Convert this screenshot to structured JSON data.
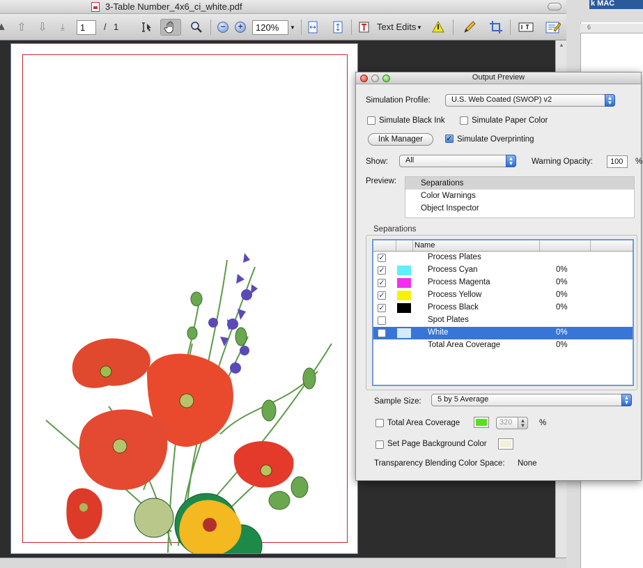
{
  "window": {
    "title": "3-Table Number_4x6_ci_white.pdf",
    "right_app_label": "k MAC"
  },
  "toolbar": {
    "page_current": "1",
    "page_sep": "/",
    "page_total": "1",
    "zoom": "120%",
    "text_edits": "Text Edits"
  },
  "ruler": {
    "mark": "6"
  },
  "panel": {
    "title": "Output Preview",
    "simulation_profile_label": "Simulation Profile:",
    "simulation_profile": "U.S. Web Coated (SWOP) v2",
    "simulate_black_ink": "Simulate Black Ink",
    "simulate_paper_color": "Simulate Paper Color",
    "ink_manager": "Ink Manager",
    "simulate_overprinting": "Simulate Overprinting",
    "show_label": "Show:",
    "show_value": "All",
    "warning_opacity_label": "Warning Opacity:",
    "warning_opacity": "100",
    "warning_opacity_unit": "%",
    "preview_label": "Preview:",
    "preview_items": [
      "Separations",
      "Color Warnings",
      "Object Inspector"
    ],
    "separations_group": "Separations",
    "sep_header_name": "Name",
    "separations": [
      {
        "name": "Process Plates",
        "pct": "",
        "checked": true,
        "color": ""
      },
      {
        "name": "Process Cyan",
        "pct": "0%",
        "checked": true,
        "color": "#5ef0fb"
      },
      {
        "name": "Process Magenta",
        "pct": "0%",
        "checked": true,
        "color": "#f22ef0"
      },
      {
        "name": "Process Yellow",
        "pct": "0%",
        "checked": true,
        "color": "#f8f20a"
      },
      {
        "name": "Process Black",
        "pct": "0%",
        "checked": true,
        "color": "#000000"
      },
      {
        "name": "Spot Plates",
        "pct": "",
        "checked": false,
        "color": ""
      },
      {
        "name": "White",
        "pct": "0%",
        "checked": false,
        "color": "#d4ecf8",
        "selected": true
      },
      {
        "name": "Total Area Coverage",
        "pct": "0%",
        "checked": null,
        "color": ""
      }
    ],
    "sample_size_label": "Sample Size:",
    "sample_size": "5 by 5 Average",
    "total_area_coverage": "Total Area Coverage",
    "tac_color": "#55e21a",
    "tac_value": "320",
    "tac_unit": "%",
    "set_page_bg": "Set Page Background Color",
    "page_bg_color": "#f2f0da",
    "blending_label": "Transparency Blending Color Space:",
    "blending_value": "None"
  }
}
